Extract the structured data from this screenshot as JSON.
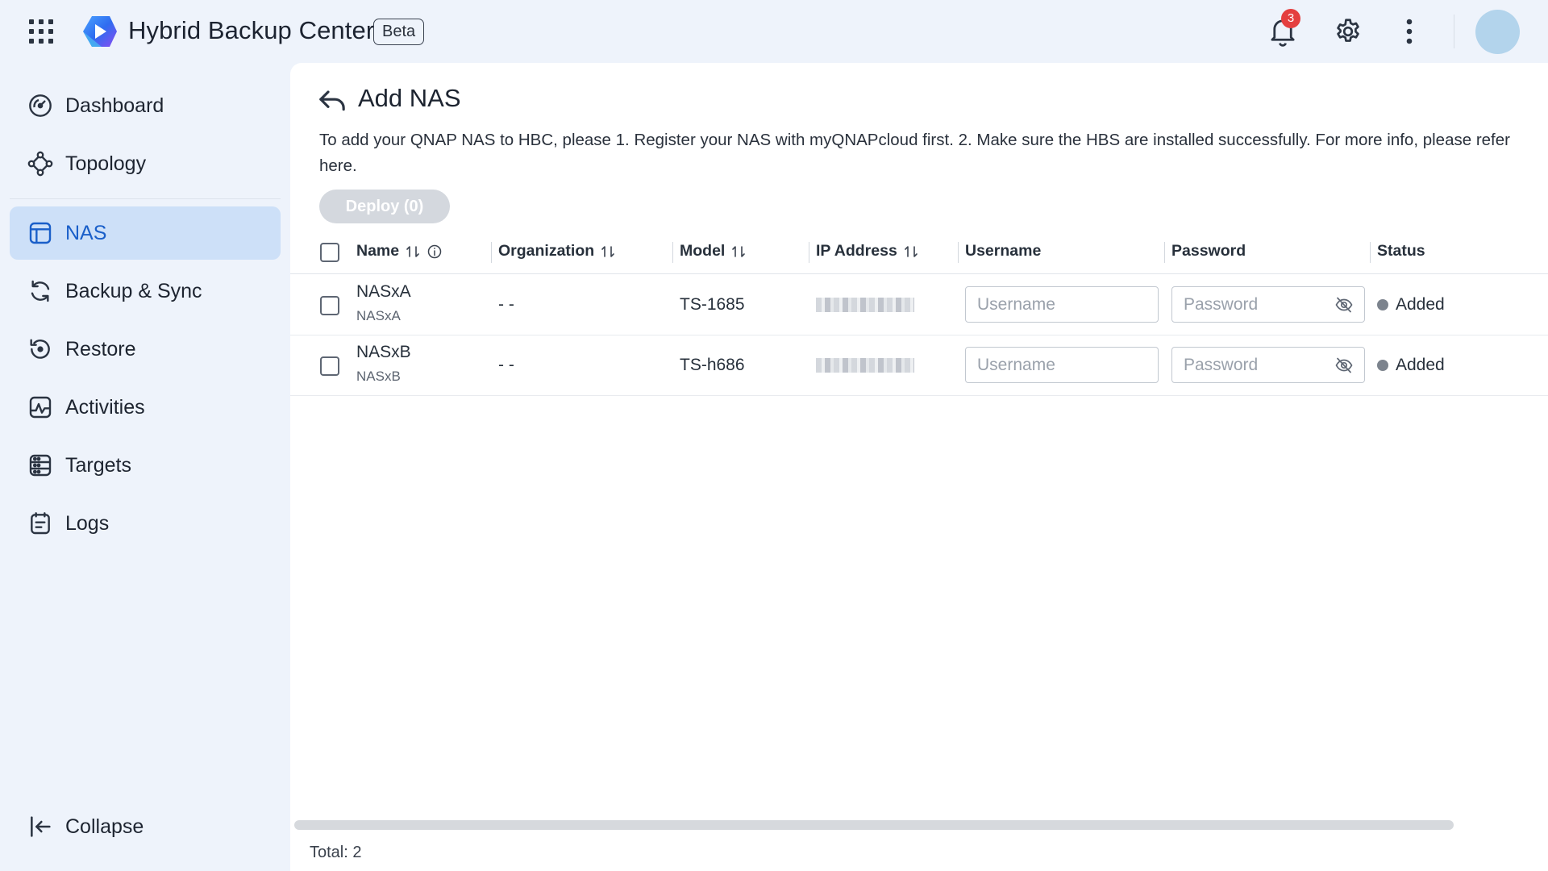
{
  "header": {
    "title": "Hybrid Backup Center",
    "badge": "Beta",
    "notification_count": "3"
  },
  "sidebar": {
    "items": [
      {
        "label": "Dashboard",
        "icon": "gauge-icon"
      },
      {
        "label": "Topology",
        "icon": "topology-icon"
      },
      {
        "label": "NAS",
        "icon": "nas-icon",
        "active": true
      },
      {
        "label": "Backup & Sync",
        "icon": "sync-icon"
      },
      {
        "label": "Restore",
        "icon": "restore-icon"
      },
      {
        "label": "Activities",
        "icon": "activity-icon"
      },
      {
        "label": "Targets",
        "icon": "targets-icon"
      },
      {
        "label": "Logs",
        "icon": "logs-icon"
      }
    ],
    "collapse_label": "Collapse"
  },
  "main": {
    "title": "Add NAS",
    "intro": "To add your QNAP NAS to HBC, please 1. Register your NAS with myQNAPcloud first. 2. Make sure the HBS are installed successfully. For more info, please refer here.",
    "deploy_label": "Deploy (0)",
    "columns": {
      "name": "Name",
      "organization": "Organization",
      "model": "Model",
      "ip": "IP Address",
      "username": "Username",
      "password": "Password",
      "status": "Status"
    },
    "rows": [
      {
        "name": "NASxA",
        "sub": "NASxA",
        "organization": "- -",
        "model": "TS-1685",
        "username_placeholder": "Username",
        "password_placeholder": "Password",
        "status": "Added"
      },
      {
        "name": "NASxB",
        "sub": "NASxB",
        "organization": "- -",
        "model": "TS-h686",
        "username_placeholder": "Username",
        "password_placeholder": "Password",
        "status": "Added"
      }
    ],
    "total": "Total: 2"
  },
  "colors": {
    "accent": "#1a5fc9",
    "active_bg": "#cde0f8",
    "sidebar_bg": "#eef3fb",
    "notification": "#e43f3f",
    "status_dot": "#7c838d"
  }
}
